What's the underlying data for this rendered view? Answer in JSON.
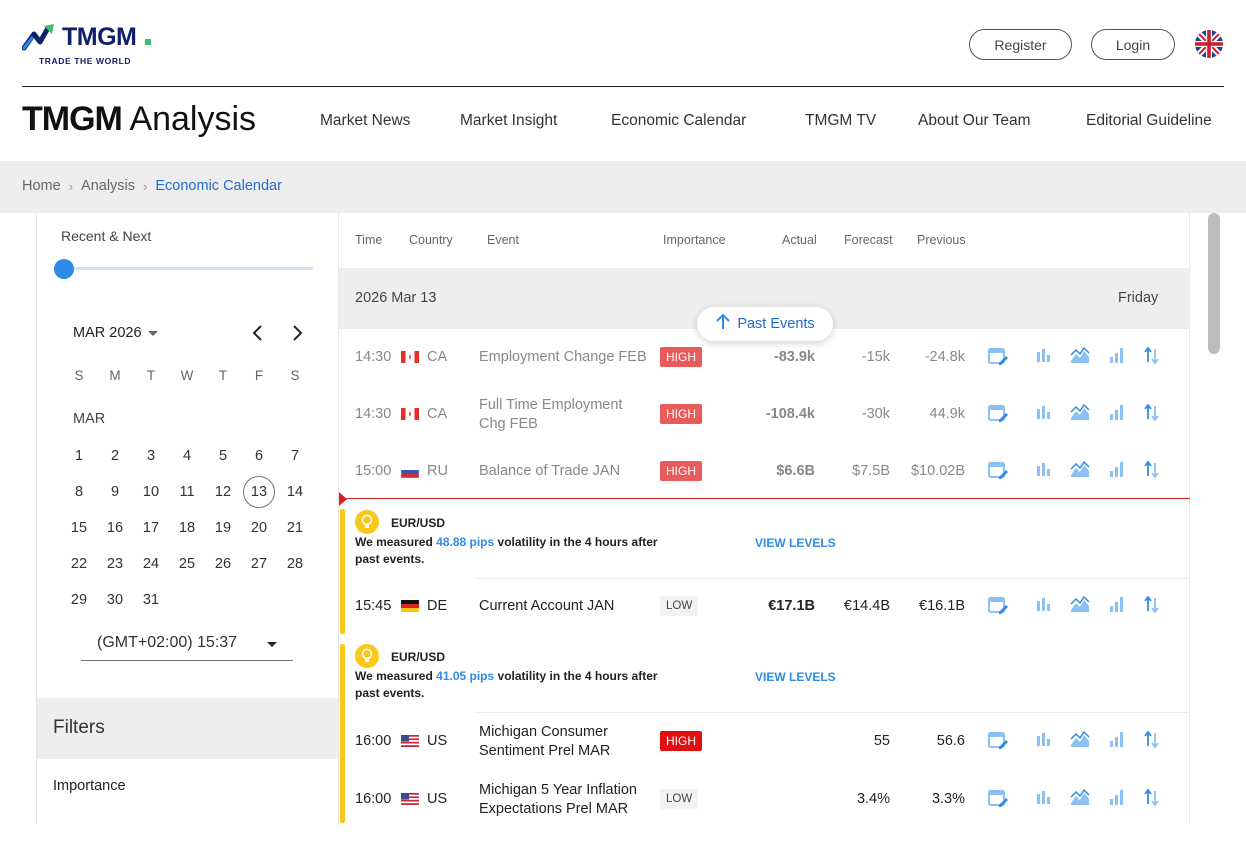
{
  "header": {
    "logo_text": "TMGM",
    "logo_tagline": "TRADE THE WORLD",
    "register_label": "Register",
    "login_label": "Login",
    "language_icon": "uk-flag-icon"
  },
  "nav": {
    "brand_bold": "TMGM",
    "brand_light": "Analysis",
    "items": [
      {
        "label": "Market News"
      },
      {
        "label": "Market Insight"
      },
      {
        "label": "Economic Calendar"
      },
      {
        "label": "TMGM TV"
      },
      {
        "label": "About Our Team"
      },
      {
        "label": "Editorial Guideline"
      }
    ]
  },
  "breadcrumb": {
    "items": [
      "Home",
      "Analysis",
      "Economic Calendar"
    ],
    "separator": "›"
  },
  "sidebar": {
    "range_label": "Recent & Next",
    "range_position": 0,
    "month_selector": "MAR 2026",
    "prev_icon": "chevron-left-icon",
    "next_icon": "chevron-right-icon",
    "weekdays": [
      "S",
      "M",
      "T",
      "W",
      "T",
      "F",
      "S"
    ],
    "month_label": "MAR",
    "days": [
      [
        "1",
        "2",
        "3",
        "4",
        "5",
        "6",
        "7"
      ],
      [
        "8",
        "9",
        "10",
        "11",
        "12",
        "13",
        "14"
      ],
      [
        "15",
        "16",
        "17",
        "18",
        "19",
        "20",
        "21"
      ],
      [
        "22",
        "23",
        "24",
        "25",
        "26",
        "27",
        "28"
      ],
      [
        "29",
        "30",
        "31"
      ]
    ],
    "selected_day": "13",
    "timezone": "(GMT+02:00) 15:37",
    "filters_title": "Filters",
    "importance_label": "Importance"
  },
  "table": {
    "columns": [
      "Time",
      "Country",
      "Event",
      "Importance",
      "Actual",
      "Forecast",
      "Previous"
    ],
    "day_date": "2026 Mar 13",
    "day_name": "Friday",
    "past_events_label": "Past Events",
    "action_icons": [
      "calendar-edit-icon",
      "bar-chart-icon",
      "area-chart-icon",
      "signal-bars-icon",
      "sort-arrows-icon"
    ],
    "rows": [
      {
        "time": "14:30",
        "country": "CA",
        "event": "Employment Change FEB",
        "importance": "HIGH",
        "actual": "-83.9k",
        "forecast": "-15k",
        "previous": "-24.8k"
      },
      {
        "time": "14:30",
        "country": "CA",
        "event": "Full Time Employment Chg FEB",
        "importance": "HIGH",
        "actual": "-108.4k",
        "forecast": "-30k",
        "previous": "44.9k"
      },
      {
        "time": "15:00",
        "country": "RU",
        "event": "Balance of Trade JAN",
        "importance": "HIGH",
        "actual": "$6.6B",
        "forecast": "$7.5B",
        "previous": "$10.02B"
      },
      {
        "time": "15:45",
        "country": "DE",
        "event": "Current Account JAN",
        "importance": "LOW",
        "actual": "€17.1B",
        "forecast": "€14.4B",
        "previous": "€16.1B"
      },
      {
        "time": "16:00",
        "country": "US",
        "event": "Michigan Consumer Sentiment Prel MAR",
        "importance": "HIGH",
        "actual": "",
        "forecast": "55",
        "previous": "56.6"
      },
      {
        "time": "16:00",
        "country": "US",
        "event": "Michigan 5 Year Inflation Expectations Prel MAR",
        "importance": "LOW",
        "actual": "",
        "forecast": "3.4%",
        "previous": "3.3%"
      }
    ],
    "insights": [
      {
        "pair": "EUR/USD",
        "text_before": "We measured ",
        "pips": "48.88 pips",
        "text_after": " volatility in the 4 hours after past events.",
        "link": "VIEW LEVELS"
      },
      {
        "pair": "EUR/USD",
        "text_before": "We measured ",
        "pips": "41.05 pips",
        "text_after": " volatility in the 4 hours after past events.",
        "link": "VIEW LEVELS"
      }
    ]
  },
  "colors": {
    "brand_navy": "#10206b",
    "link_blue": "#2369c8",
    "icon_blue": "#2f8be6",
    "high_red": "#e95a5a",
    "high_red_active": "#e20f12",
    "insight_yellow": "#f8c81c",
    "now_line_red": "#d92222"
  }
}
